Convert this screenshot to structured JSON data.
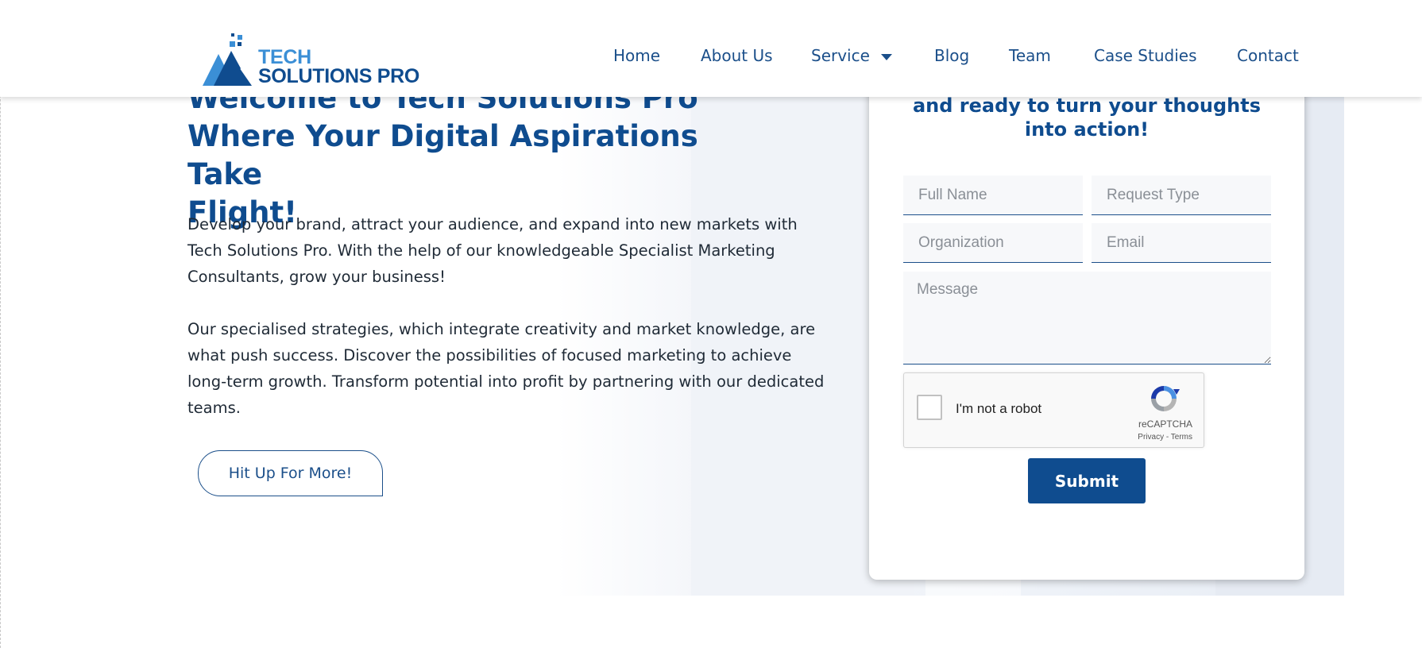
{
  "header": {
    "logo": {
      "line1": "TECH",
      "line2": "SOLUTIONS PRO"
    },
    "nav": [
      {
        "label": "Home"
      },
      {
        "label": "About Us"
      },
      {
        "label": "Service"
      },
      {
        "label": "Blog"
      },
      {
        "label": "Team"
      },
      {
        "label": "Case Studies"
      },
      {
        "label": "Contact"
      }
    ]
  },
  "hero": {
    "title_line1": "Welcome to Tech Solutions Pro",
    "title_line2": "Where Your Digital Aspirations Take",
    "title_line3": "Flight!",
    "paragraph1": "Develop your brand, attract your audience, and expand into new markets with Tech Solutions Pro. With the help of our knowledgeable Specialist Marketing Consultants, grow your business!",
    "paragraph2": "Our specialised strategies, which integrate creativity and market knowledge, are what push success. Discover the possibilities of focused marketing to achieve long-term growth. Transform potential into profit by partnering with our dedicated teams.",
    "cta_label": "Hit Up For More!"
  },
  "form": {
    "heading": "and ready to turn your thoughts into action!",
    "full_name_placeholder": "Full Name",
    "request_type_placeholder": "Request Type",
    "organization_placeholder": "Organization",
    "email_placeholder": "Email",
    "message_placeholder": "Message",
    "recaptcha": {
      "label": "I'm not a robot",
      "brand": "reCAPTCHA",
      "links": "Privacy - Terms"
    },
    "submit_label": "Submit"
  },
  "colors": {
    "brand_dark": "#0f4c8f",
    "brand_light": "#3b8fd6",
    "nav_text": "#1b4f8a"
  }
}
